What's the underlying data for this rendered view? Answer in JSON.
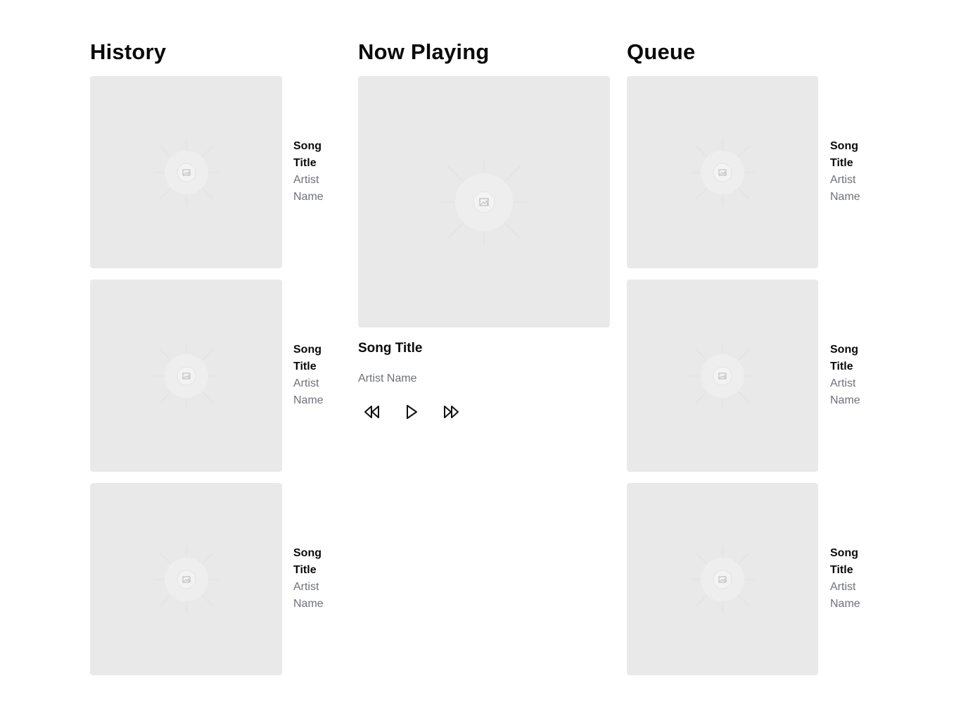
{
  "history": {
    "title": "History",
    "items": [
      {
        "title": "Song Title",
        "artist": "Artist Name"
      },
      {
        "title": "Song Title",
        "artist": "Artist Name"
      },
      {
        "title": "Song Title",
        "artist": "Artist Name"
      }
    ]
  },
  "now_playing": {
    "heading": "Now Playing",
    "title": "Song Title",
    "artist": "Artist Name",
    "controls": {
      "rewind_icon": "rewind-icon",
      "play_icon": "play-icon",
      "fast_forward_icon": "fast-forward-icon"
    }
  },
  "queue": {
    "title": "Queue",
    "items": [
      {
        "title": "Song Title",
        "artist": "Artist Name"
      },
      {
        "title": "Song Title",
        "artist": "Artist Name"
      },
      {
        "title": "Song Title",
        "artist": "Artist Name"
      }
    ]
  },
  "colors": {
    "placeholder_bg": "#e9e9e9",
    "heading": "#0a0a0a",
    "secondary_text": "#6e7179"
  }
}
